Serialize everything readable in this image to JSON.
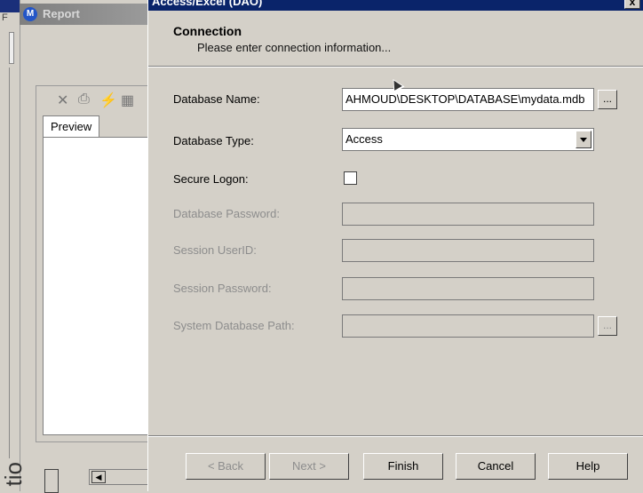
{
  "background_app": {
    "title": "Report",
    "title_icon": "M",
    "left_letter": "F",
    "preview_tab": "Preview",
    "toolbar_icons": [
      "close-icon",
      "print-icon",
      "lightning-icon",
      "grid-icon"
    ],
    "side_text": "tio"
  },
  "dialog": {
    "title": "Access/Excel (DAO)",
    "close_label": "x",
    "header": {
      "title": "Connection",
      "subtitle": "Please enter connection information..."
    },
    "fields": {
      "database_name": {
        "label": "Database Name:",
        "value": "AHMOUD\\DESKTOP\\DATABASE\\mydata.mdb",
        "browse_label": "..."
      },
      "database_type": {
        "label": "Database Type:",
        "value": "Access"
      },
      "secure_logon": {
        "label": "Secure Logon:",
        "checked": false
      },
      "database_password": {
        "label": "Database Password:",
        "value": ""
      },
      "session_userid": {
        "label": "Session UserID:",
        "value": ""
      },
      "session_password": {
        "label": "Session Password:",
        "value": ""
      },
      "system_database_path": {
        "label": "System Database Path:",
        "value": "",
        "browse_label": "..."
      }
    },
    "buttons": {
      "back": "< Back",
      "next": "Next >",
      "finish": "Finish",
      "cancel": "Cancel",
      "help": "Help"
    }
  }
}
